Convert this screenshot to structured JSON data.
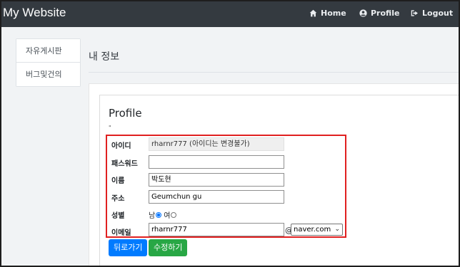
{
  "navbar": {
    "brand": "My Website",
    "links": [
      {
        "label": "Home",
        "icon": "home-icon"
      },
      {
        "label": "Profile",
        "icon": "user-circle-icon"
      },
      {
        "label": "Logout",
        "icon": "sign-out-icon"
      }
    ]
  },
  "sidebar": {
    "items": [
      {
        "label": "자유게시판"
      },
      {
        "label": "버그및건의"
      }
    ]
  },
  "page": {
    "title": "내 정보"
  },
  "profile": {
    "heading": "Profile",
    "mark": "\"",
    "fields": {
      "id_label": "아이디",
      "id_value": "rharnr777 (아이디는 변경불가)",
      "password_label": "패스워드",
      "password_value": "",
      "name_label": "이름",
      "name_value": "박도현",
      "address_label": "주소",
      "address_value": "Geumchun gu",
      "gender_label": "성별",
      "gender_male": "남",
      "gender_female": "여",
      "email_label": "이메일",
      "email_local": "rharnr777",
      "email_at": "@",
      "email_domain": "naver.com"
    },
    "buttons": {
      "back": "뒤로가기",
      "edit": "수정하기"
    }
  },
  "colors": {
    "navbar": "#343a40",
    "primary": "#007bff",
    "success": "#28a745",
    "highlight": "#e02020"
  }
}
